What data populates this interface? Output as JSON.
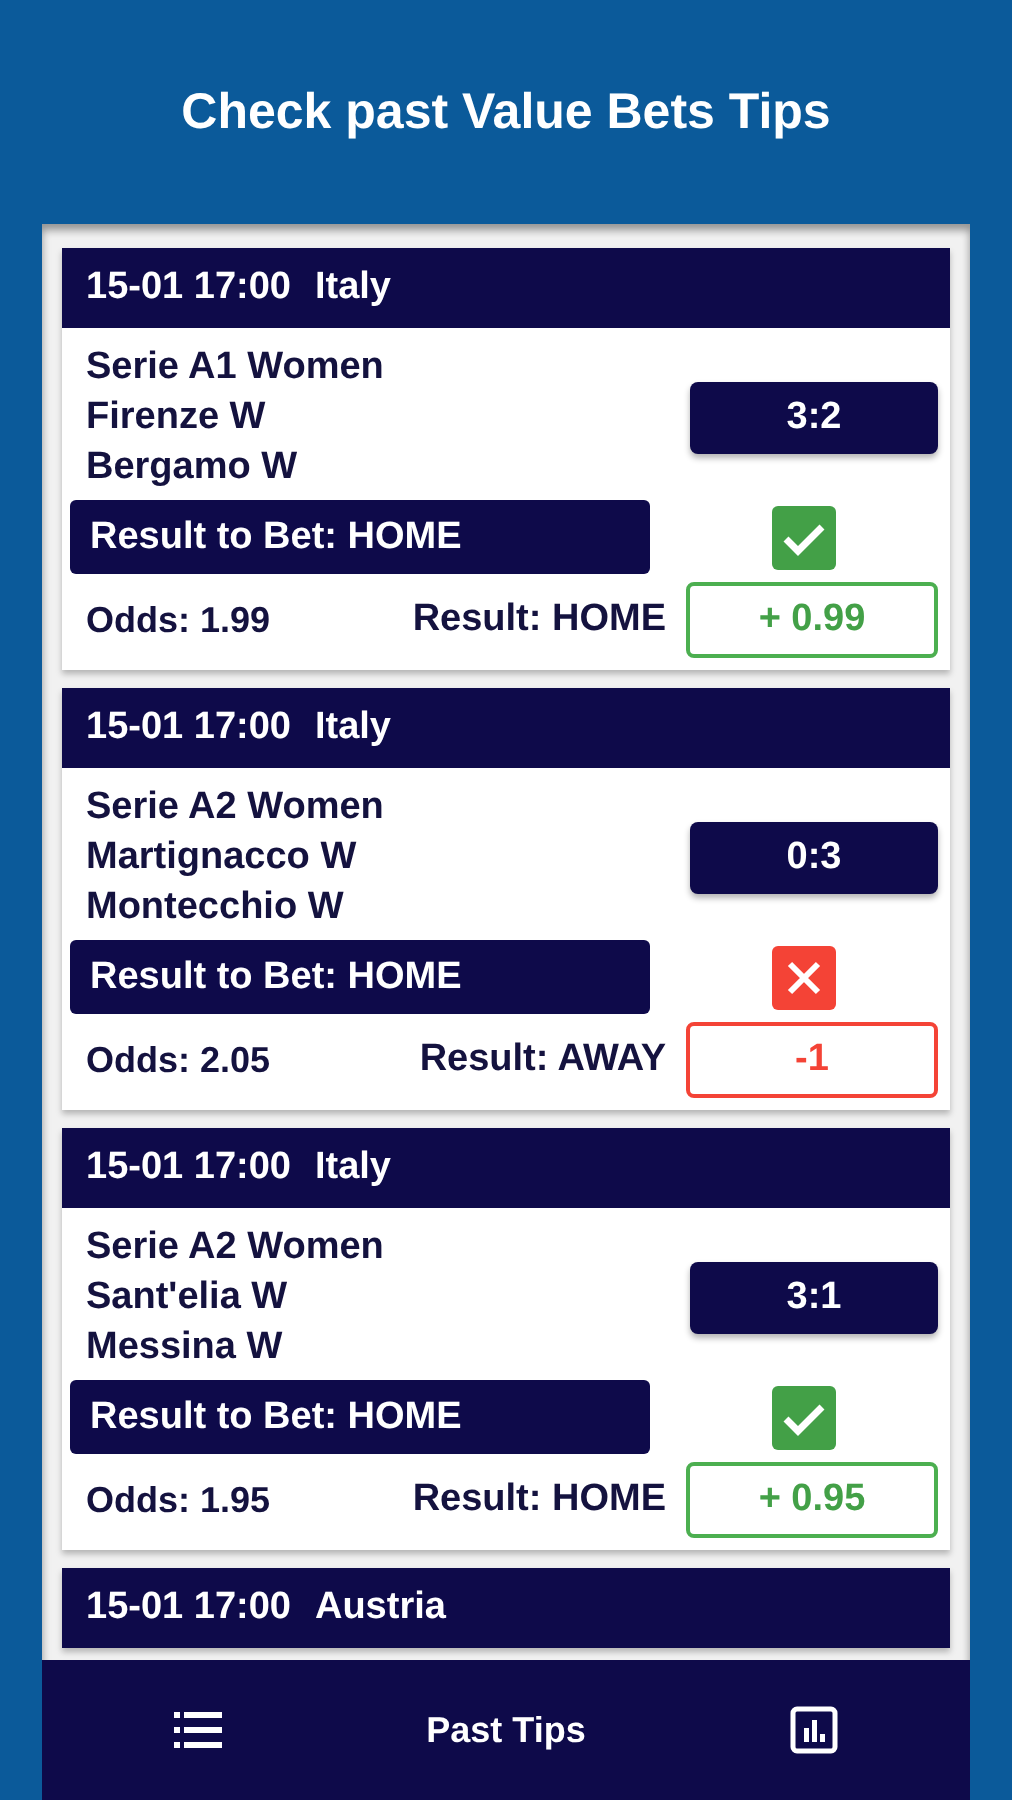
{
  "title": "Check past Value Bets Tips",
  "tips": [
    {
      "datetime": "15-01 17:00",
      "country": "Italy",
      "league": "Serie A1 Women",
      "home": "Firenze W",
      "away": "Bergamo W",
      "score": "3:2",
      "bet": "Result to Bet: HOME",
      "won": true,
      "odds": "Odds: 1.99",
      "result": "Result: HOME",
      "profit": "+ 0.99"
    },
    {
      "datetime": "15-01 17:00",
      "country": "Italy",
      "league": "Serie A2 Women",
      "home": "Martignacco W",
      "away": "Montecchio W",
      "score": "0:3",
      "bet": "Result to Bet: HOME",
      "won": false,
      "odds": "Odds: 2.05",
      "result": "Result: AWAY",
      "profit": "-1"
    },
    {
      "datetime": "15-01 17:00",
      "country": "Italy",
      "league": "Serie A2 Women",
      "home": "Sant'elia W",
      "away": "Messina W",
      "score": "3:1",
      "bet": "Result to Bet: HOME",
      "won": true,
      "odds": "Odds: 1.95",
      "result": "Result: HOME",
      "profit": "+ 0.95"
    },
    {
      "datetime": "15-01 17:00",
      "country": "Austria"
    }
  ],
  "nav": {
    "title": "Past Tips"
  }
}
